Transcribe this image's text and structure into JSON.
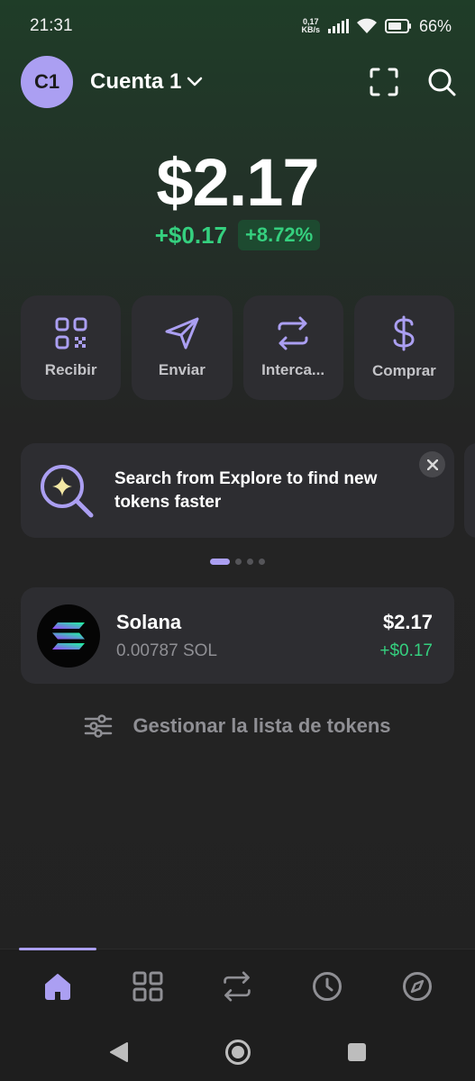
{
  "status_bar": {
    "time": "21:31",
    "net_speed_value": "0,17",
    "net_speed_unit": "KB/s",
    "battery": "66%"
  },
  "header": {
    "avatar_initials": "C1",
    "account_name": "Cuenta 1"
  },
  "portfolio": {
    "balance": "$2.17",
    "change_abs": "+$0.17",
    "change_pct": "+8.72%"
  },
  "actions": [
    {
      "label": "Recibir",
      "icon": "qr-code-icon"
    },
    {
      "label": "Enviar",
      "icon": "send-icon"
    },
    {
      "label": "Interca...",
      "icon": "swap-icon"
    },
    {
      "label": "Comprar",
      "icon": "dollar-icon"
    }
  ],
  "promo": {
    "text": "Search from Explore to find new tokens faster",
    "icon": "search-sparkle-icon"
  },
  "carousel": {
    "total": 4,
    "active": 0
  },
  "tokens": [
    {
      "name": "Solana",
      "amount": "0.00787 SOL",
      "value": "$2.17",
      "change": "+$0.17",
      "icon": "solana-logo-icon"
    }
  ],
  "manage": {
    "label": "Gestionar la lista de tokens"
  },
  "bottom_nav": [
    {
      "id": "home",
      "icon": "home-icon",
      "active": true
    },
    {
      "id": "collectibles",
      "icon": "grid-icon",
      "active": false
    },
    {
      "id": "swap",
      "icon": "swap-icon",
      "active": false
    },
    {
      "id": "activity",
      "icon": "clock-icon",
      "active": false
    },
    {
      "id": "explore",
      "icon": "compass-icon",
      "active": false
    }
  ],
  "colors": {
    "accent": "#ab9ff2",
    "positive": "#35d07f",
    "card": "#2d2d31"
  }
}
